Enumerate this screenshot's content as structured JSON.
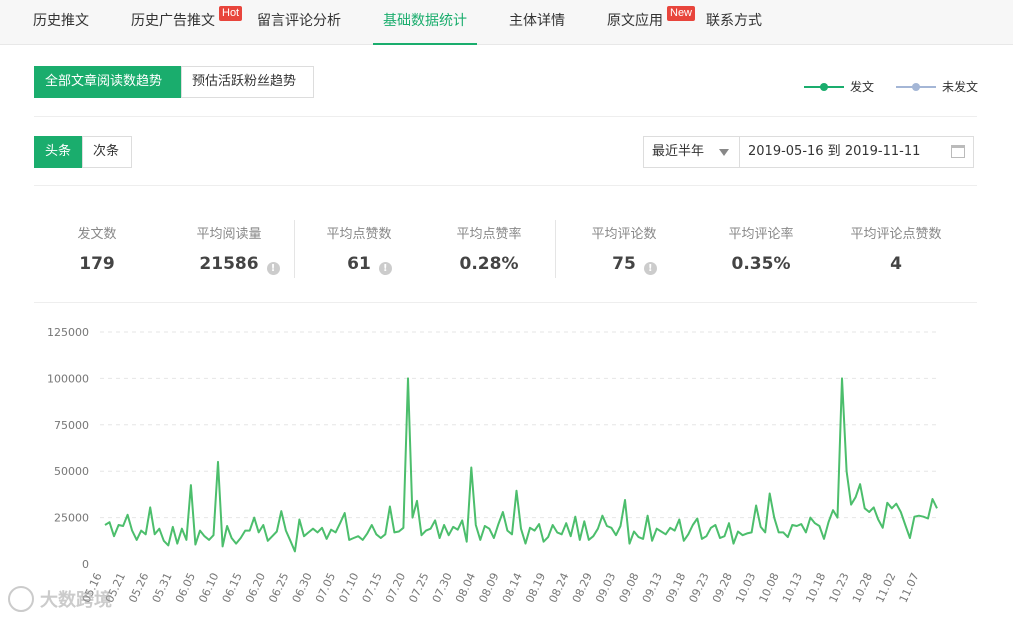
{
  "nav": {
    "tabs": [
      {
        "label": "历史推文"
      },
      {
        "label": "历史广告推文",
        "badge": "Hot"
      },
      {
        "label": "留言评论分析"
      },
      {
        "label": "基础数据统计",
        "active": true
      },
      {
        "label": "主体详情"
      },
      {
        "label": "原文应用",
        "badge": "New"
      },
      {
        "label": "联系方式"
      }
    ]
  },
  "trend_tabs": {
    "all_reads": "全部文章阅读数趋势",
    "fans": "预估活跃粉丝趋势"
  },
  "legend": [
    {
      "label": "发文",
      "color": "#1aad6d"
    },
    {
      "label": "未发文",
      "color": "#a4b6d6"
    }
  ],
  "position_tabs": {
    "headline": "头条",
    "secondary": "次条"
  },
  "filter": {
    "period": "最近半年",
    "date_range": "2019-05-16 到 2019-11-11"
  },
  "stats": [
    {
      "label": "发文数",
      "value": "179"
    },
    {
      "label": "平均阅读量",
      "value": "21586",
      "help": "!"
    },
    {
      "label": "平均点赞数",
      "value": "61",
      "help": "!"
    },
    {
      "label": "平均点赞率",
      "value": "0.28%"
    },
    {
      "label": "平均评论数",
      "value": "75",
      "help": "!"
    },
    {
      "label": "平均评论率",
      "value": "0.35%"
    },
    {
      "label": "平均评论点赞数",
      "value": "4"
    }
  ],
  "watermark": "大数跨境",
  "chart_data": {
    "type": "line",
    "ylim": [
      0,
      125000
    ],
    "yticks": [
      0,
      25000,
      50000,
      75000,
      100000,
      125000
    ],
    "xticks": [
      "05.16",
      "05.21",
      "05.26",
      "05.31",
      "06.05",
      "06.10",
      "06.15",
      "06.20",
      "06.25",
      "06.30",
      "07.05",
      "07.10",
      "07.15",
      "07.20",
      "07.25",
      "07.30",
      "08.04",
      "08.09",
      "08.14",
      "08.19",
      "08.24",
      "08.29",
      "09.03",
      "09.08",
      "09.13",
      "09.18",
      "09.23",
      "09.28",
      "10.03",
      "10.08",
      "10.13",
      "10.18",
      "10.23",
      "10.28",
      "11.02",
      "11.07"
    ],
    "grid": true,
    "series": [
      {
        "name": "发文",
        "color": "#4cbe6c",
        "values": [
          21000,
          22500,
          15000,
          21000,
          20500,
          26500,
          18000,
          13000,
          18000,
          16000,
          30500,
          16000,
          19000,
          12500,
          10000,
          20000,
          11000,
          19000,
          13000,
          42500,
          10500,
          18000,
          15000,
          13000,
          15500,
          55000,
          9500,
          20500,
          14000,
          11000,
          14000,
          18000,
          18000,
          25000,
          17000,
          21000,
          12500,
          15000,
          17500,
          28500,
          18000,
          12500,
          6800,
          24000,
          15000,
          17000,
          19000,
          17000,
          19500,
          13500,
          18500,
          17000,
          22000,
          27500,
          13000,
          14000,
          15000,
          13000,
          16500,
          21000,
          16000,
          14000,
          16000,
          31000,
          17000,
          17500,
          19500,
          100000,
          25000,
          34000,
          15500,
          18000,
          19000,
          23500,
          14000,
          21000,
          15500,
          20000,
          18500,
          23500,
          12000,
          52000,
          21000,
          13000,
          20500,
          19000,
          14000,
          21500,
          28000,
          18000,
          16000,
          39500,
          19000,
          11000,
          19500,
          18000,
          21500,
          12000,
          14500,
          21000,
          17000,
          16000,
          22000,
          15000,
          25500,
          13000,
          23000,
          13000,
          15000,
          19000,
          26000,
          20500,
          19500,
          15500,
          20500,
          34500,
          11000,
          17500,
          14500,
          13500,
          26000,
          12500,
          19000,
          17500,
          16000,
          19500,
          18000,
          24000,
          12500,
          16000,
          21000,
          24500,
          13500,
          15000,
          19500,
          21000,
          14000,
          15000,
          22000,
          11000,
          17500,
          15500,
          16500,
          17000,
          31500,
          20000,
          17000,
          38000,
          25000,
          17000,
          17000,
          14500,
          21000,
          20500,
          21500,
          17000,
          25000,
          22000,
          20500,
          13500,
          22500,
          29000,
          25000,
          100000,
          50000,
          32000,
          36000,
          43000,
          30000,
          28000,
          30500,
          24000,
          19500,
          33000,
          30000,
          32500,
          28000,
          21000,
          14000,
          25500,
          26000,
          25500,
          24500,
          35000,
          30000
        ]
      }
    ]
  }
}
